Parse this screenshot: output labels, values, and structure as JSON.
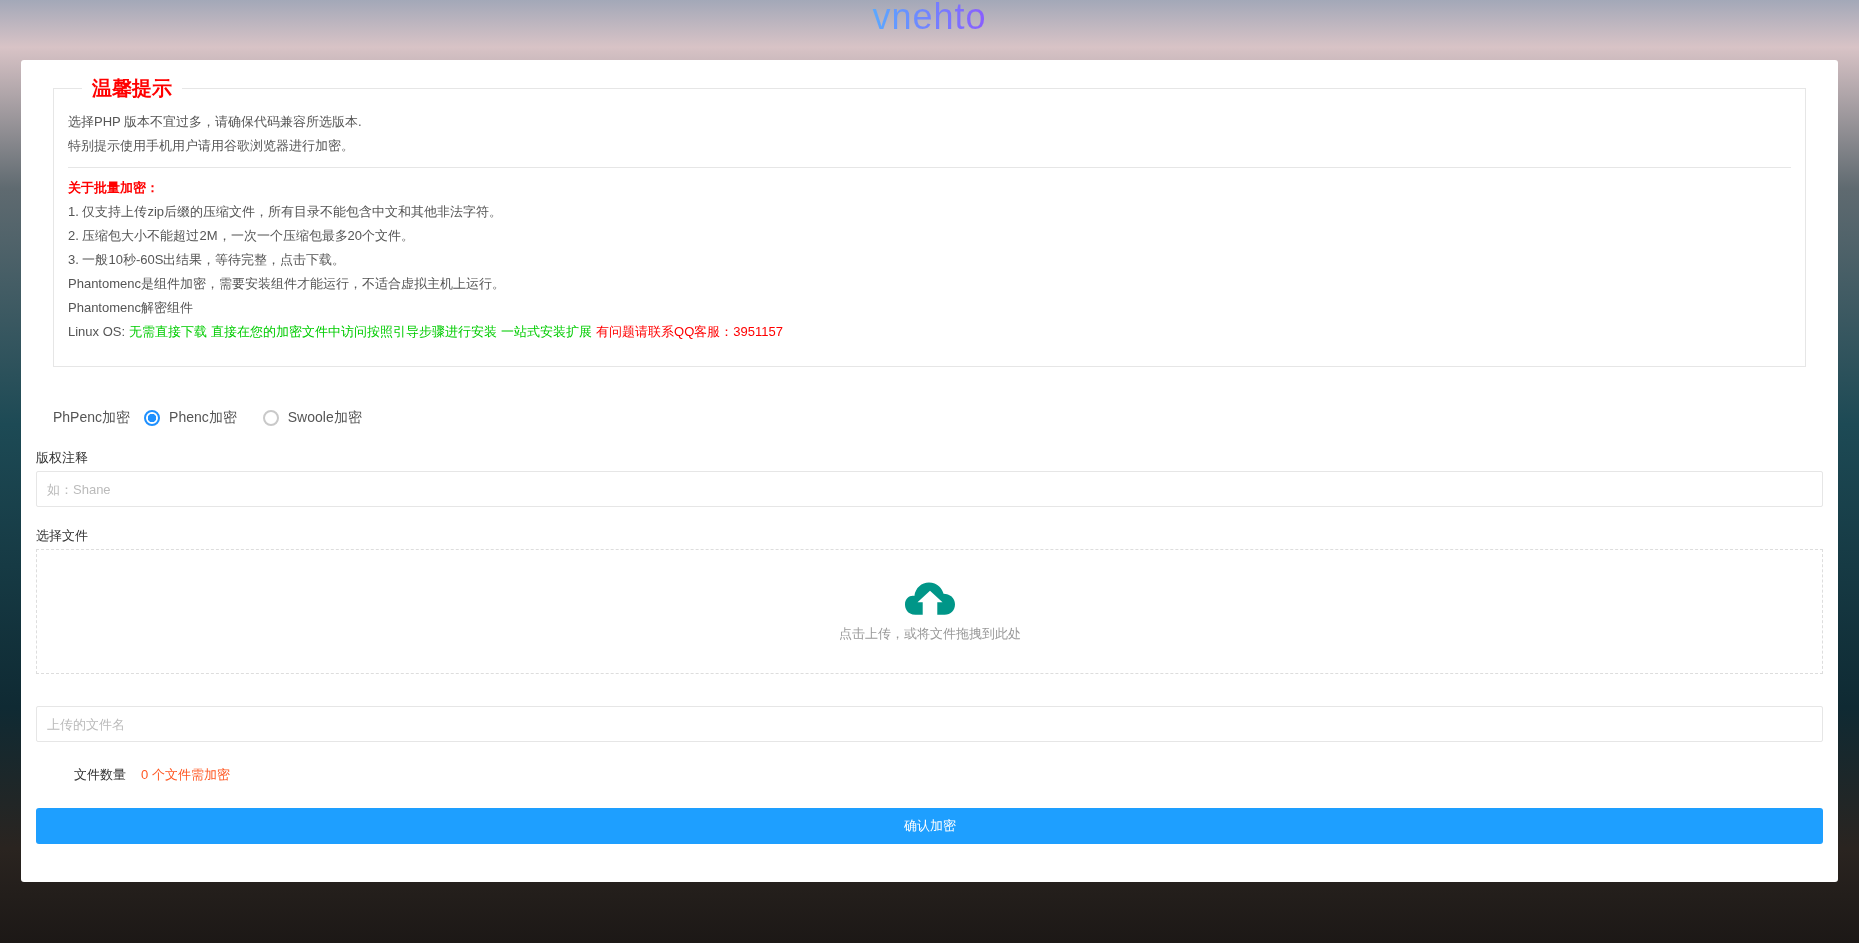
{
  "logo": "vnehto",
  "notice": {
    "title": "温馨提示",
    "intro": [
      "选择PHP 版本不宜过多，请确保代码兼容所选版本.",
      "特别提示使用手机用户请用谷歌浏览器进行加密。"
    ],
    "heading": "关于批量加密：",
    "lines": [
      [
        {
          "text": "1. 仅支持上传zip后缀的压缩文件，所有目录不能包含中文和其他非法字符。",
          "kind": "plain"
        }
      ],
      [
        {
          "text": "2. 压缩包大小不能超过2M，一次一个压缩包最多20个文件。",
          "kind": "plain"
        }
      ],
      [
        {
          "text": "3. 一般10秒-60S出结果，等待完整，点击下载。",
          "kind": "plain"
        }
      ],
      [
        {
          "text": "Phantomenc是组件加密，需要安装组件才能运行，不适合虚拟主机上运行。",
          "kind": "plain"
        }
      ],
      [
        {
          "text": "Phantomenc解密组件",
          "kind": "plain"
        }
      ],
      [
        {
          "text": "Linux OS:",
          "kind": "plain"
        },
        {
          "text": "无需直接下载",
          "kind": "highlight"
        },
        {
          "text": "直接在您的加密文件中访问按照引导步骤进行安装",
          "kind": "highlight"
        },
        {
          "text": "一站式安装扩展",
          "kind": "highlight"
        },
        {
          "text": "有问题请联系QQ客服：3951157",
          "kind": "warning"
        }
      ]
    ]
  },
  "encryption": {
    "label": "PhPenc加密",
    "options": [
      {
        "label": "Phenc加密",
        "selected": true
      },
      {
        "label": "Swoole加密",
        "selected": false
      }
    ]
  },
  "copyright": {
    "label": "版权注释",
    "placeholder": "如：Shane"
  },
  "upload": {
    "label": "选择文件",
    "hint": "点击上传，或将文件拖拽到此处"
  },
  "filename": {
    "placeholder": "上传的文件名"
  },
  "file_count": {
    "label": "文件数量",
    "value": "0 个文件需加密"
  },
  "submit": "确认加密"
}
